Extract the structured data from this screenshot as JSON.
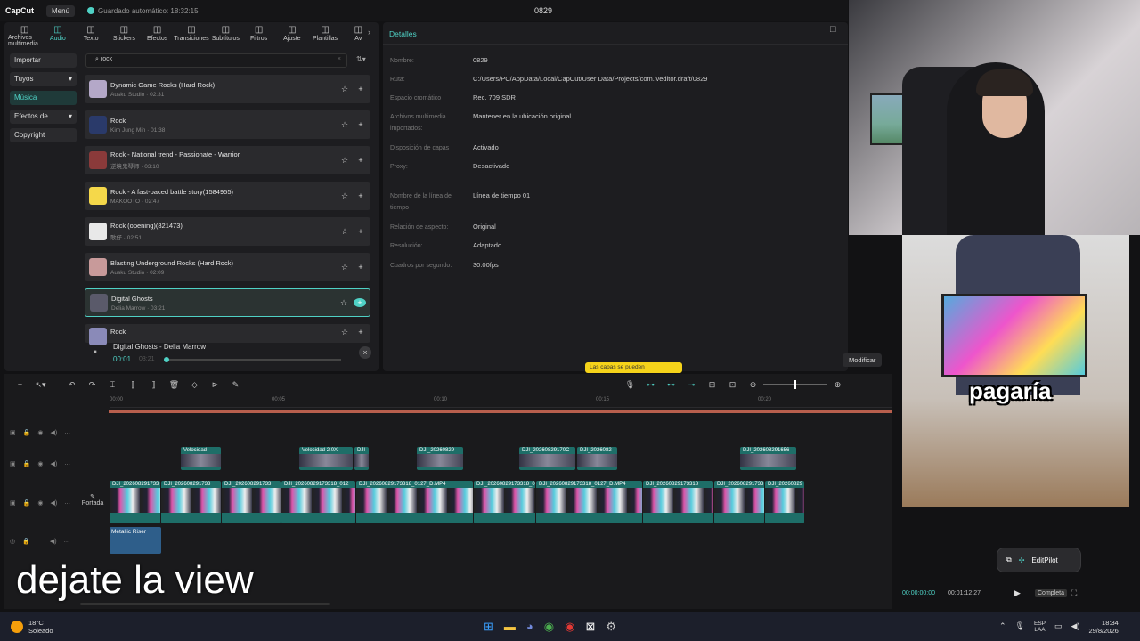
{
  "app": {
    "logo": "CapCut",
    "menu": "Menú",
    "autosave": "Guardado automático: 18:32:15",
    "project": "0829"
  },
  "toolbar": [
    "Archivos multimedia",
    "Audio",
    "Texto",
    "Stickers",
    "Efectos",
    "Transiciones",
    "Subtítulos",
    "Filtros",
    "Ajuste",
    "Plantillas",
    "Av"
  ],
  "toolbar_icons": [
    "media-icon",
    "audio-icon",
    "text-icon",
    "sticker-icon",
    "effects-icon",
    "transitions-icon",
    "subtitles-icon",
    "filters-icon",
    "adjust-icon",
    "templates-icon",
    "more-icon"
  ],
  "sidenav": [
    "Importar",
    "Tuyos",
    "Música",
    "Efectos de ...",
    "Copyright"
  ],
  "search": {
    "value": "rock"
  },
  "tracks": [
    {
      "title": "Dynamic Game Rocks (Hard Rock)",
      "sub": "Ausku Studio · 02:31",
      "color": "#b4a8c8"
    },
    {
      "title": "Rock",
      "sub": "Kim Jung Min · 01:38",
      "color": "#2a3a6a"
    },
    {
      "title": "Rock - National trend - Passionate - Warrior",
      "sub": "逆境鬼琴师 · 03:10",
      "color": "#8a3a3a"
    },
    {
      "title": "Rock - A fast-paced battle story(1584955)",
      "sub": "MAKOOTO · 02:47",
      "color": "#f5d84a"
    },
    {
      "title": "Rock (opening)(821473)",
      "sub": "歌仔 · 02:51",
      "color": "#e8e8e8"
    },
    {
      "title": "Blasting Underground Rocks (Hard Rock)",
      "sub": "Ausku Studio · 02:09",
      "color": "#c89a9a"
    },
    {
      "title": "Digital Ghosts",
      "sub": "Delia Marrow · 03:21",
      "color": "#5a5a6a"
    },
    {
      "title": "Rock",
      "sub": "",
      "color": "#8a8ab8"
    }
  ],
  "player": {
    "title": "Digital Ghosts - Delia Marrow",
    "current": "00:01",
    "total": "03:21"
  },
  "details": {
    "header": "Detalles",
    "rows": [
      {
        "label": "Nombre:",
        "value": "0829"
      },
      {
        "label": "Ruta:",
        "value": "C:/Users/PC/AppData/Local/CapCut/User Data/Projects/com.lveditor.draft/0829"
      },
      {
        "label": "Espacio cromático",
        "value": "Rec. 709 SDR"
      },
      {
        "label": "Archivos multimedia importados:",
        "value": "Mantener en la ubicación original"
      },
      {
        "label": "Disposición de capas",
        "value": "Activado"
      },
      {
        "label": "Proxy:",
        "value": "Desactivado"
      },
      {
        "label": "Nombre de la línea de tiempo",
        "value": "Línea de tiempo 01"
      },
      {
        "label": "Relación de aspecto:",
        "value": "Original"
      },
      {
        "label": "Resolución:",
        "value": "Adaptado"
      },
      {
        "label": "Cuadros por segundo:",
        "value": "30.00fps"
      }
    ],
    "modify": "Modificar",
    "tooltip": "Las capas se pueden"
  },
  "timeline": {
    "ticks": [
      "00:00",
      "00:05",
      "00:10",
      "00:15",
      "00:20"
    ],
    "cover": "Portada",
    "clips_top": [
      "Velocidad",
      "Velocidad 2.0X",
      "DJI",
      "DJI_20260829",
      "DJI_20260829170C",
      "DJI_2026082",
      "DJI_202608291656"
    ],
    "clips_main": [
      "DJI_202608291733",
      "DJI_202608291733",
      "DJI_202608291733",
      "DJI_20260829173318_012",
      "DJI_20260829173318_0127_D.MP4",
      "DJI_20260829173318_0127",
      "DJI_20260829173318_0127_D.MP4",
      "DJI_20260829173318",
      "DJI_202608291733",
      "DJI_20260829"
    ],
    "audio_clip": "Metallic Riser"
  },
  "preview": {
    "overlay_word": "pagaría",
    "editpilot": "EditPilot",
    "time_current": "00:00:00:00",
    "time_total": "00:01:12:27",
    "complete": "Completa"
  },
  "subtitle": "dejate la view",
  "taskbar": {
    "temp": "18°C",
    "weather": "Soleado",
    "lang1": "ESP",
    "lang2": "LAA",
    "time": "18:34",
    "date": "29/8/2026"
  }
}
